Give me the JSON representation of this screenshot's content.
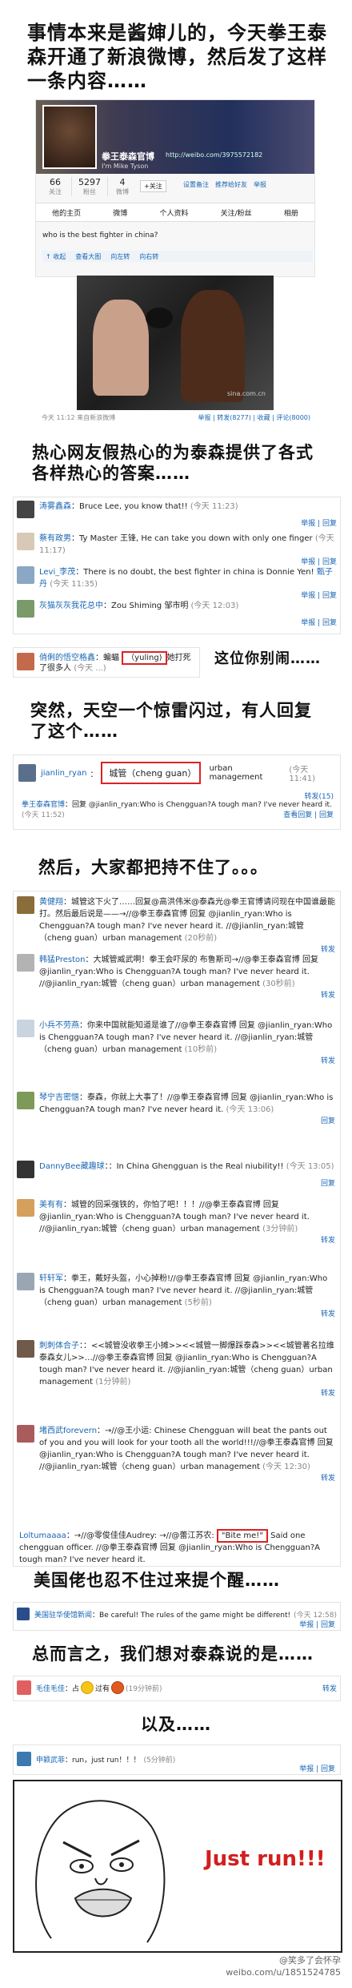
{
  "captions": {
    "intro": "事情本来是酱婶儿的，今天拳王泰森开通了新浪微博，然后发了这样一条内容……",
    "netizens": "热心网友假热心的为泰森提供了各式各样热心的答案……",
    "youbie": "这位你别闹……",
    "sudden": "突然，天空一个惊雷闪过，有人回复了这个……",
    "then": "然后，大家都把持不住了。。。",
    "american": "美国佬也忍不住过来提个醒……",
    "summary": "总而言之，我们想对泰森说的是……",
    "andthen": "以及……",
    "justrun": "Just run!!!"
  },
  "profile": {
    "name": "拳王泰森官博",
    "name_en": "I'm Mike Tyson",
    "url": "http://weibo.com/3975572182",
    "stats": [
      {
        "num": "66",
        "label": "关注"
      },
      {
        "num": "5297",
        "label": "粉丝"
      },
      {
        "num": "4",
        "label": "微博"
      }
    ],
    "follow_label": "+关注",
    "actions": [
      "设置备注",
      "推荐给好友",
      "举报"
    ],
    "tabs": [
      "他的主页",
      "微博",
      "个人资料",
      "关注/粉丝",
      "相册"
    ],
    "post_text": "who is the best fighter in china?",
    "post_tools": [
      "↑ 收起",
      "查看大图",
      "向左转",
      "向右转"
    ],
    "post_meta": "今天 11:12 来自新浪微博",
    "post_actions": "举报 | 转发(8277) | 收藏 | 评论(8000)",
    "photo_credit": "sina.com.cn"
  },
  "comments1": [
    {
      "user": "涛雾鑫森",
      "text": "：Bruce Lee, you know that!!",
      "time": "(今天 11:23)",
      "ops": "举报 | 回复"
    },
    {
      "user": "蔡有政男",
      "text": "：Ty Master 王锋, He can take you down with only one finger",
      "time": "(今天 11:17)",
      "ops": "举报 | 回复"
    },
    {
      "user": "Levi_李茂",
      "text": "：There is no doubt, the best fighter in china is Donnie Yen!",
      "extra": "甄子丹",
      "time": "(今天 11:35)",
      "ops": "举报 | 回复"
    },
    {
      "user": "灰猫灰灰我花总中",
      "text": "：Zou Shiming 邹市明",
      "time": "(今天 12:03)",
      "ops": "举报 | 回复"
    }
  ],
  "comment_youbie": {
    "user": "俏俐的悟空格鑫",
    "text_a": "：蝙蝠",
    "text_box": "（yuling)",
    "text_b": "她打死了很多人",
    "time": "(今天 ...)"
  },
  "comment_chengguan": {
    "user": "jianlin_ryan",
    "text_box": "城管（cheng guan）",
    "text_b": "urban management",
    "time": "(今天 11:41)",
    "ops": "转发(15)",
    "reply_user": "拳王泰森官博",
    "reply_text": "：回复 @jianlin_ryan:Who is Chengguan?A tough man? I've never heard it.",
    "reply_time": "(今天 11:52)",
    "reply_ops": "查看回复 | 回复"
  },
  "comments2": [
    {
      "user": "黄健翔",
      "text": "城管这下火了……回复@高洪伟米@泰森光@拳王官博请问现在中国谁最能打。然后最后说是——→//@拳王泰森官博 回复 @jianlin_ryan:Who is Chengguan?A tough man? I've never heard it. //@jianlin_ryan:城管（cheng guan）urban management",
      "time": "(20秒前)",
      "ops": "转发"
    },
    {
      "user": "韩猛Preston",
      "text": "大城管威武啊！拳王会吓尿的 布鲁斯司→//@拳王泰森官博 回复 @jianlin_ryan:Who is Chengguan?A tough man? I've never heard it. //@jianlin_ryan:城管（cheng guan）urban management",
      "time": "(30秒前)",
      "ops": "转发"
    },
    {
      "user": "小兵不劳燕",
      "text": "你来中国就能知道是谁了//@拳王泰森官博 回复 @jianlin_ryan:Who is Chengguan?A tough man? I've never heard it. //@jianlin_ryan:城管（cheng guan）urban management",
      "time": "(10秒前)",
      "ops": "转发"
    },
    {
      "user": "琴宁吉密惬",
      "text": "泰森，你就上大事了！//@拳王泰森官博 回复 @jianlin_ryan:Who is Chengguan?A tough man? I've never heard it.",
      "time": "(今天 13:06)",
      "ops": "回复"
    },
    {
      "user": "DannyBee藏趣球",
      "text": "：In China Ghengguan is the Real niubility!!",
      "time": "(今天 13:05)",
      "ops": "回复"
    },
    {
      "user": "美有有",
      "text": "城管的回采强铁的，你怕了吧！！！//@拳王泰森官博 回复 @jianlin_ryan:Who is Chengguan?A tough man? I've never heard it. //@jianlin_ryan:城管（cheng guan）urban management",
      "time": "(3分钟前)",
      "ops": "转发"
    },
    {
      "user": "轩轩军",
      "text": "拳王，戴好头盔，小心掉粉!//@拳王泰森官博 回复 @jianlin_ryan:Who is Chengguan?A tough man? I've never heard it. //@jianlin_ryan:城管（cheng guan）urban management",
      "time": "(5秒前)",
      "ops": "转发"
    },
    {
      "user": "刺刺体合子",
      "text": "：<<城管没收拳王小摊>><<城管一脚爆踩泰森>><<城管著名拉维泰森女儿>>…//@拳王泰森官博 回复 @jianlin_ryan:Who is Chengguan?A tough man? I've never heard it. //@jianlin_ryan:城管（cheng guan）urban management",
      "time": "(1分钟前)",
      "ops": "转发"
    },
    {
      "user": "堵西武forevern",
      "text": "→//@王小运: Chinese Chengguan will beat the pants out of you and you will look for your tooth all the world!!!//@拳王泰森官博 回复 @jianlin_ryan:Who is Chengguan?A tough man? I've never heard it. //@jianlin_ryan:城管（cheng guan）urban management",
      "time": "(今天 12:30)",
      "ops": "转发"
    }
  ],
  "comment_biteme": {
    "user": "Loltumaaaa",
    "text_a": "：→//@零俊佳佳Audrey: →//@蕾江苏农:",
    "text_box": "\"Bite me!\"",
    "text_b": "Said one chengguan officer. //@拳王泰森官博 回复 @jianlin_ryan:Who is Chengguan?A tough man? I've never heard it."
  },
  "comment_american": {
    "user": "美国驻华使馆新闻",
    "text": "：Be careful! The rules of the game might be different!",
    "time": "(今天 12:58)",
    "ops": "举报 | 回复"
  },
  "comment_summary": {
    "user": "毛佳毛佳",
    "text_a": "：占",
    "text_b": "过有",
    "time": "(19分钟前)",
    "ops": "转发"
  },
  "comment_run": {
    "user": "申颖武菲",
    "text": "：run，just run！！！",
    "time": "(5分钟前)",
    "ops": "举报 | 回复"
  },
  "watermark": {
    "line1": "@笑多了会怀孕",
    "line2": "weibo.com/u/1851524785"
  },
  "colors": {
    "link": "#1a66b3",
    "highlight": "#d22222",
    "accent": "#e35b00"
  }
}
